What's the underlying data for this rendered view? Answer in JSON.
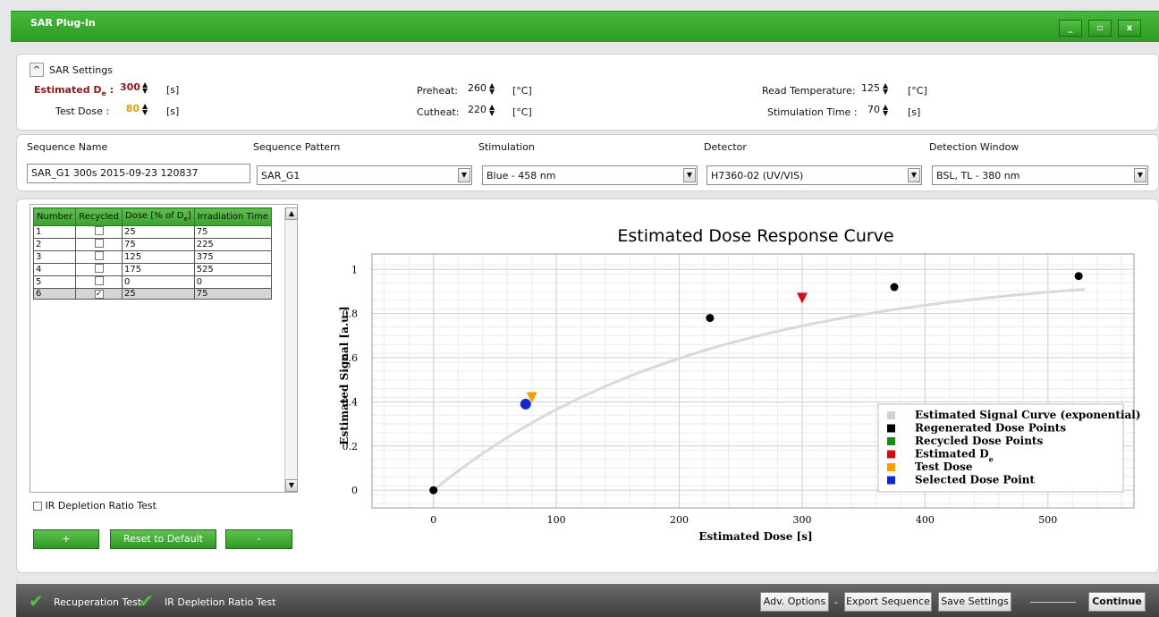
{
  "window": {
    "title": "SAR Plug-In",
    "controls": {
      "minimize": "_",
      "maximize": "▫",
      "close": "x"
    }
  },
  "sar_settings": {
    "toggle_icon": "^",
    "title": "SAR Settings",
    "estimated_de": {
      "label": "Estimated D",
      "label_sub": "e",
      "label_suffix": " :",
      "value": "300",
      "unit": "[s]"
    },
    "test_dose": {
      "label": "Test Dose :",
      "value": "80",
      "unit": "[s]"
    },
    "preheat": {
      "label": "Preheat:",
      "value": "260",
      "unit": "[°C]"
    },
    "cutheat": {
      "label": "Cutheat:",
      "value": "220",
      "unit": "[°C]"
    },
    "read_temperature": {
      "label": "Read Temperature:",
      "value": "125",
      "unit": "[°C]"
    },
    "stimulation_time": {
      "label": "Stimulation Time :",
      "value": "70",
      "unit": "[s]"
    }
  },
  "sequence": {
    "name_label": "Sequence Name",
    "name_value": "SAR_G1 300s 2015-09-23 120837",
    "pattern_label": "Sequence Pattern",
    "pattern_value": "SAR_G1",
    "stimulation_label": "Stimulation",
    "stimulation_value": "Blue - 458 nm",
    "detector_label": "Detector",
    "detector_value": "H7360-02 (UV/VIS)",
    "window_label": "Detection Window",
    "window_value": "BSL, TL - 380 nm"
  },
  "table": {
    "headers": {
      "number": "Number",
      "recycled": "Recycled",
      "dose": "Dose [% of D",
      "dose_sub": "e",
      "dose_suffix": "]",
      "irradiation": "Irradiation Time"
    },
    "rows": [
      {
        "number": "1",
        "recycled": false,
        "dose": "25",
        "time": "75"
      },
      {
        "number": "2",
        "recycled": false,
        "dose": "75",
        "time": "225"
      },
      {
        "number": "3",
        "recycled": false,
        "dose": "125",
        "time": "375"
      },
      {
        "number": "4",
        "recycled": false,
        "dose": "175",
        "time": "525"
      },
      {
        "number": "5",
        "recycled": false,
        "dose": "0",
        "time": "0"
      },
      {
        "number": "6",
        "recycled": true,
        "dose": "25",
        "time": "75"
      }
    ],
    "selected_row": 6
  },
  "ir_depletion_checkbox": {
    "label": "IR Depletion Ratio Test",
    "checked": false
  },
  "buttons": {
    "add": "+",
    "reset": "Reset to Default",
    "remove": "-"
  },
  "footer": {
    "check1_label": "Recuperation Test",
    "check2_label": "IR Depletion Ratio Test",
    "adv_options": "Adv. Options",
    "separator": "-",
    "export_sequence": "Export Sequence",
    "save_settings": "Save Settings",
    "continue": "Continue"
  },
  "colors": {
    "title_green": "#3aa02f",
    "estimated_de_label": "#8b1a1a",
    "test_dose_value": "#e69a10",
    "curve": "#d9d9d9",
    "regenerated": "#000000",
    "recycled": "#1a8a1a",
    "estimated_de": "#d01010",
    "test_dose": "#f5a000",
    "selected": "#1428c8"
  },
  "chart_data": {
    "type": "scatter",
    "title": "Estimated Dose Response Curve",
    "xlabel": "Estimated Dose [s]",
    "ylabel": "Estimated Signal [a.u.]",
    "xlim": [
      -50,
      570
    ],
    "ylim": [
      -0.08,
      1.07
    ],
    "x_ticks": [
      0,
      100,
      200,
      300,
      400,
      500
    ],
    "y_ticks": [
      0,
      0.2,
      0.4,
      0.6,
      0.8,
      1
    ],
    "grid": true,
    "legend_position": "bottom-right",
    "curve": {
      "name": "Estimated Signal Curve (exponential)",
      "model": "1 - exp(-x/220)",
      "x_range": [
        0,
        530
      ]
    },
    "series": [
      {
        "name": "Regenerated Dose Points",
        "marker": "circle",
        "points": [
          [
            0,
            0
          ],
          [
            225,
            0.78
          ],
          [
            375,
            0.92
          ],
          [
            525,
            0.97
          ]
        ]
      },
      {
        "name": "Recycled Dose Points",
        "marker": "circle",
        "points": []
      },
      {
        "name": "Estimated D",
        "name_sub": "e",
        "marker": "triangle-down",
        "points": [
          [
            300,
            0.87
          ]
        ]
      },
      {
        "name": "Test Dose",
        "marker": "triangle-down",
        "points": [
          [
            80,
            0.42
          ]
        ]
      },
      {
        "name": "Selected Dose Point",
        "marker": "circle",
        "points": [
          [
            75,
            0.39
          ]
        ]
      }
    ]
  }
}
